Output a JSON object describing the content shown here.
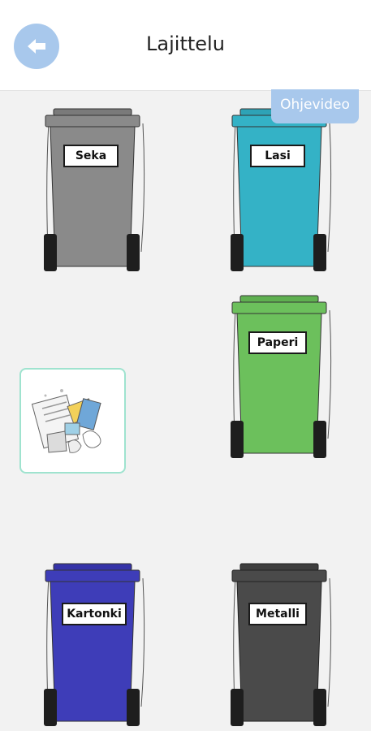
{
  "header": {
    "title": "Lajittelu",
    "back_icon": "arrow-left-icon"
  },
  "video_button": {
    "label": "Ohjevideo"
  },
  "bins": [
    {
      "id": "seka",
      "label": "Seka",
      "color": "#8a8a8a"
    },
    {
      "id": "lasi",
      "label": "Lasi",
      "color": "#34b2c6"
    },
    {
      "id": "paperi",
      "label": "Paperi",
      "color": "#6cc05c"
    },
    {
      "id": "kartonki",
      "label": "Kartonki",
      "color": "#3e3db8"
    },
    {
      "id": "metalli",
      "label": "Metalli",
      "color": "#4a4a4a"
    }
  ],
  "draggable_item": {
    "icon": "mixed-paper-waste-icon"
  }
}
